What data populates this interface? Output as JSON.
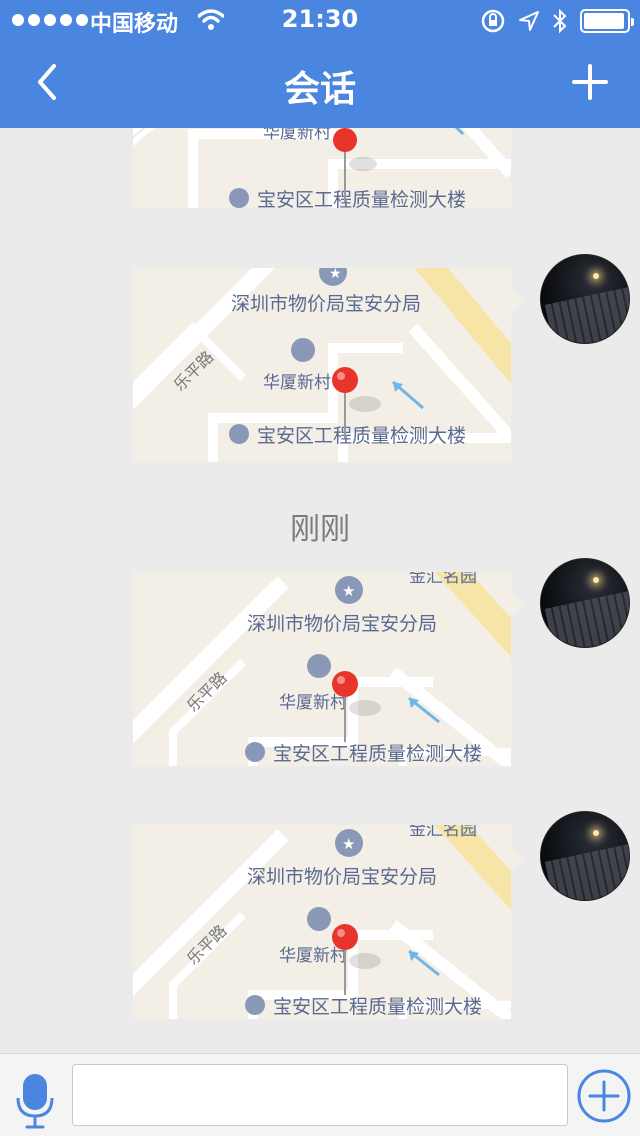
{
  "status_bar": {
    "carrier": "中国移动",
    "time": "21:30"
  },
  "nav": {
    "title": "会话",
    "back_icon": "chevron-left-icon",
    "add_icon": "plus-icon"
  },
  "map_labels": {
    "road": "乐平路",
    "poi_bureau": "深圳市物价局宝安分局",
    "poi_village": "华厦新村",
    "poi_building": "宝安区工程质量检测大楼",
    "poi_top": "金汇名园"
  },
  "messages": [
    {
      "type": "location",
      "partial": true
    },
    {
      "type": "location"
    },
    {
      "type": "location"
    },
    {
      "type": "location"
    }
  ],
  "timestamp": "刚刚",
  "input": {
    "mic_icon": "microphone-icon",
    "value": "",
    "add_icon": "plus-circle-icon"
  },
  "colors": {
    "nav_bg": "#4a86e0",
    "map_bg": "#f3efe6",
    "pin": "#e8352b",
    "poi_icon": "#8a98b8"
  }
}
